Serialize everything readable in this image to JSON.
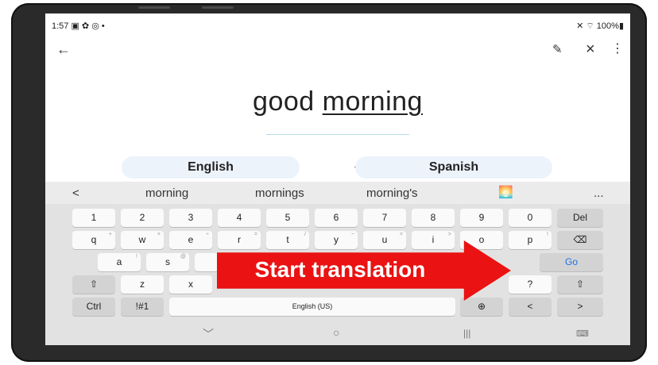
{
  "status": {
    "time": "1:57",
    "left_icons": "▣ ✿ ◎ •",
    "right": "✕ ⌔ 100%▮"
  },
  "header": {
    "back_icon": "←",
    "handwriting_icon": "✎",
    "close_icon": "×",
    "menu_icon": "⋮"
  },
  "input_text": {
    "plain": "good ",
    "underlined": "morning"
  },
  "languages": {
    "source": "English",
    "target": "Spanish",
    "swap_icon": "↔"
  },
  "suggestions": {
    "back": "<",
    "items": [
      "morning",
      "mornings",
      "morning's"
    ],
    "emoji": "🌅",
    "more": "..."
  },
  "keyboard": {
    "row_numbers": [
      "1",
      "2",
      "3",
      "4",
      "5",
      "6",
      "7",
      "8",
      "9",
      "0",
      "Del"
    ],
    "row_q": [
      "q",
      "w",
      "e",
      "r",
      "t",
      "y",
      "u",
      "i",
      "o",
      "p",
      "⌫"
    ],
    "row_q_hints": [
      "+",
      "×",
      "÷",
      "=",
      "/",
      "−",
      "<",
      ">",
      "",
      "!",
      ""
    ],
    "row_a": [
      "a",
      "s",
      "Go"
    ],
    "row_a_hints": [
      "!",
      "@",
      ""
    ],
    "row_z": [
      "⇧",
      "z",
      "x",
      "?",
      "⇧"
    ],
    "row_bottom": [
      "Ctrl",
      "!#1",
      "English (US)",
      "⊕",
      "<",
      ">"
    ]
  },
  "nav": {
    "down": "﹀",
    "home": "○",
    "recents": "|||",
    "keyboard_toggle": "⌨"
  },
  "annotation": {
    "text": "Start translation",
    "color": "#ea1212"
  }
}
